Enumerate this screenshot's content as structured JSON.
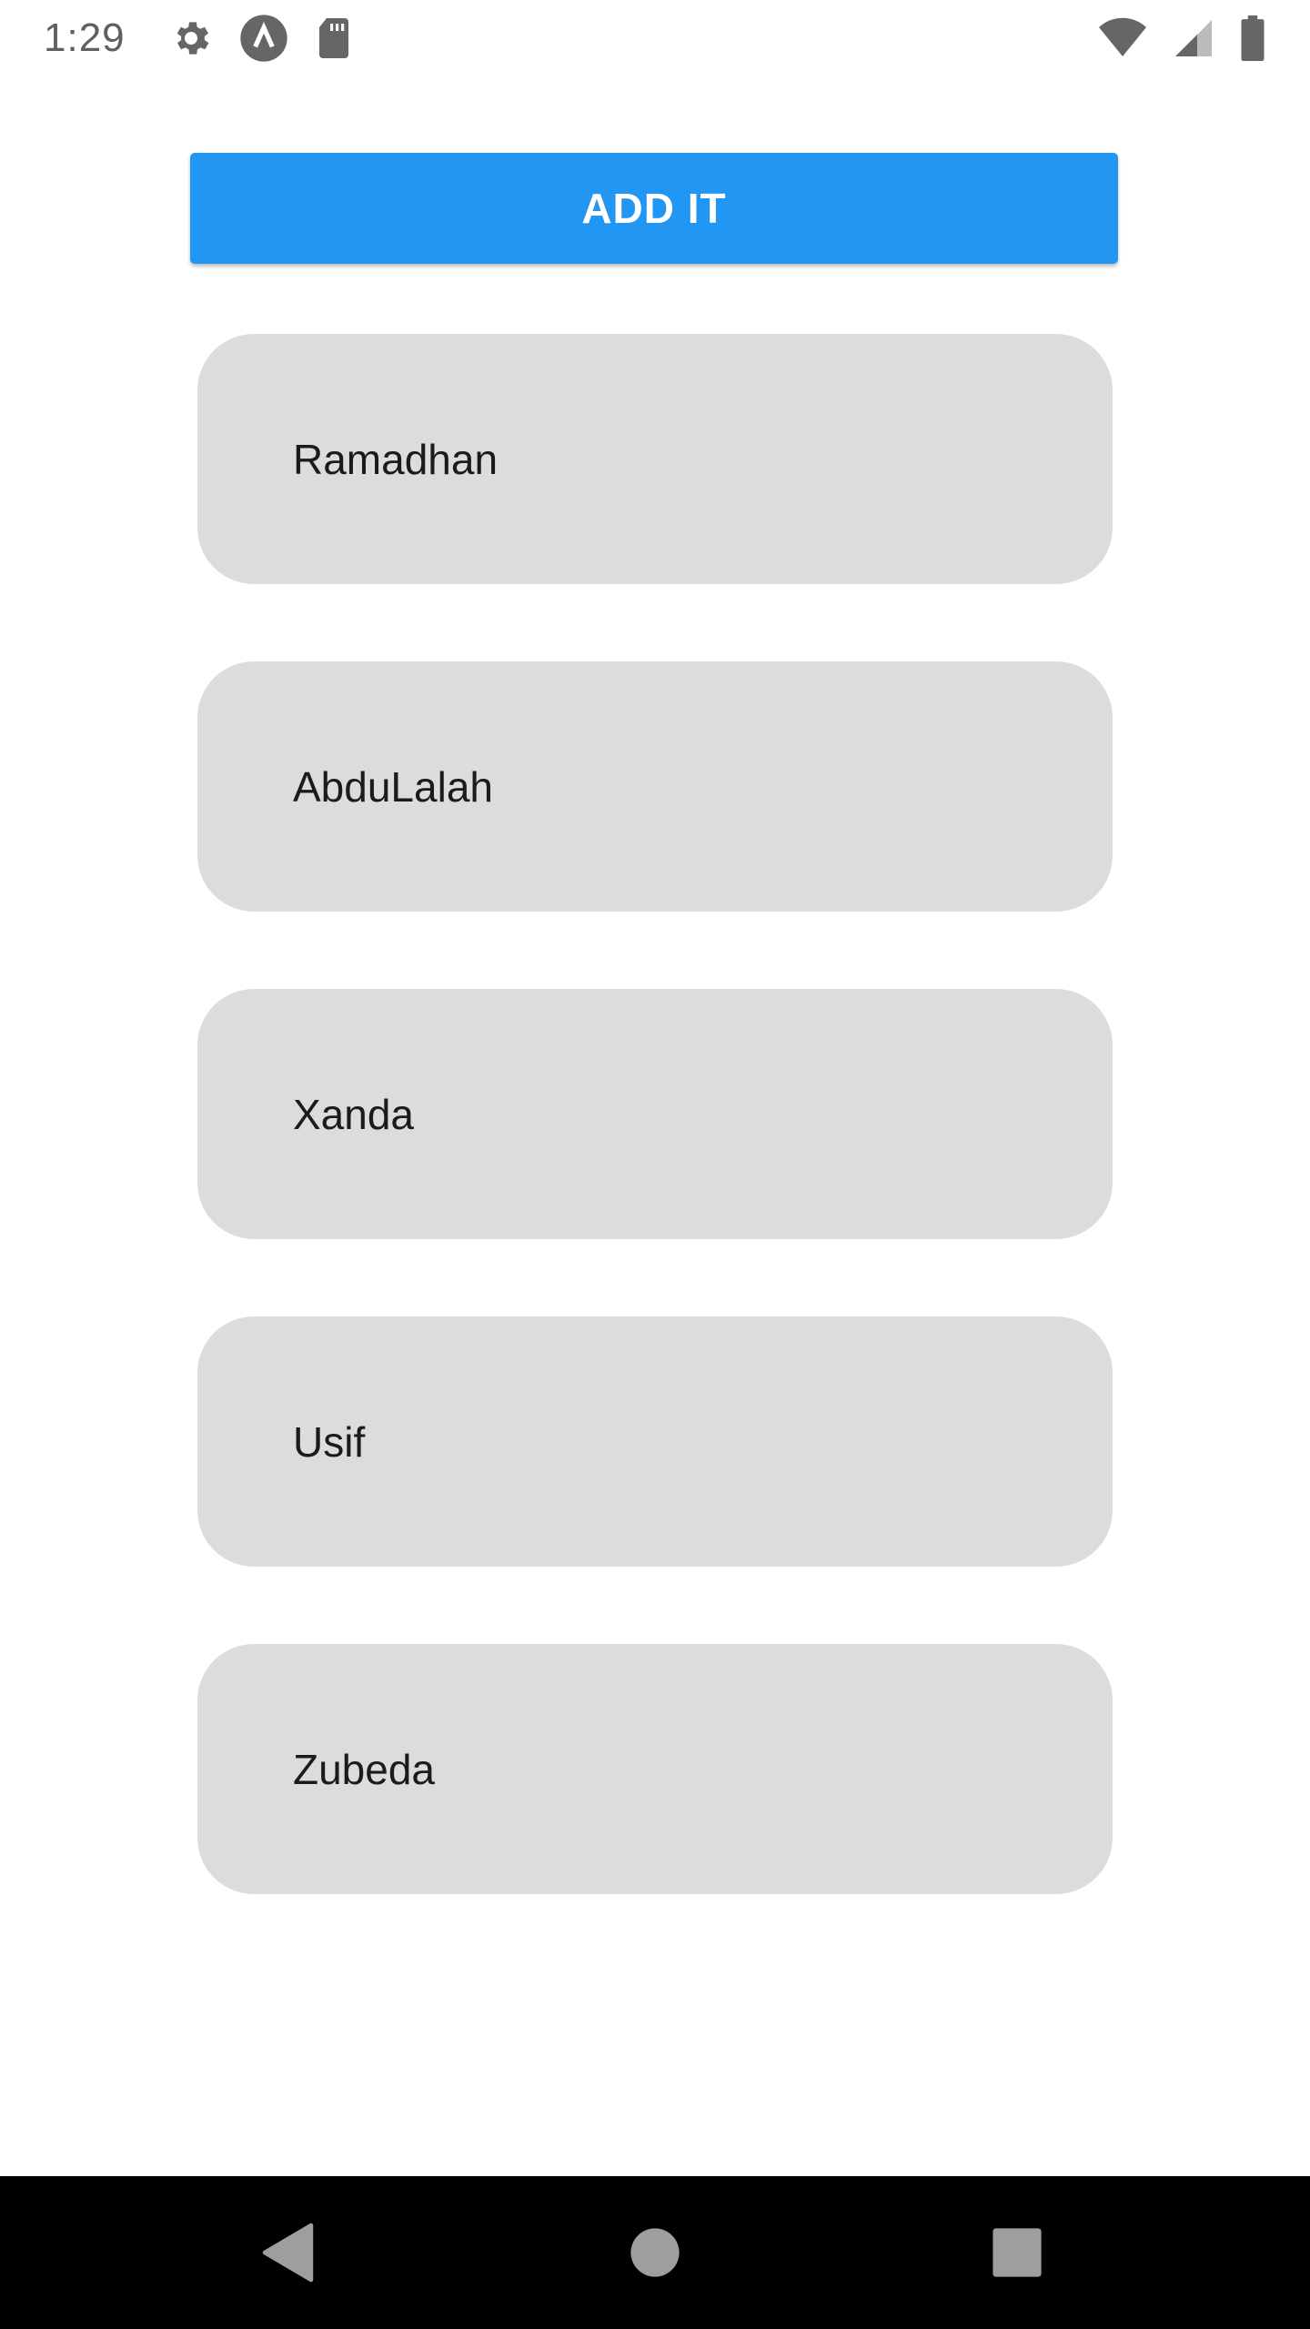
{
  "status_bar": {
    "time": "1:29",
    "left_icons": [
      "gear-icon",
      "a-circle-icon",
      "sd-card-icon"
    ],
    "right_icons": [
      "wifi-icon",
      "cell-signal-icon",
      "battery-icon"
    ]
  },
  "add_button": {
    "label": "ADD IT",
    "color": "#2196f3"
  },
  "list": {
    "items": [
      {
        "label": "Ramadhan"
      },
      {
        "label": "AbduLalah"
      },
      {
        "label": "Xanda"
      },
      {
        "label": "Usif"
      },
      {
        "label": "Zubeda"
      }
    ],
    "item_color": "#dcdcdc"
  },
  "nav_bar": {
    "buttons": [
      "back-icon",
      "home-icon",
      "recents-icon"
    ]
  }
}
